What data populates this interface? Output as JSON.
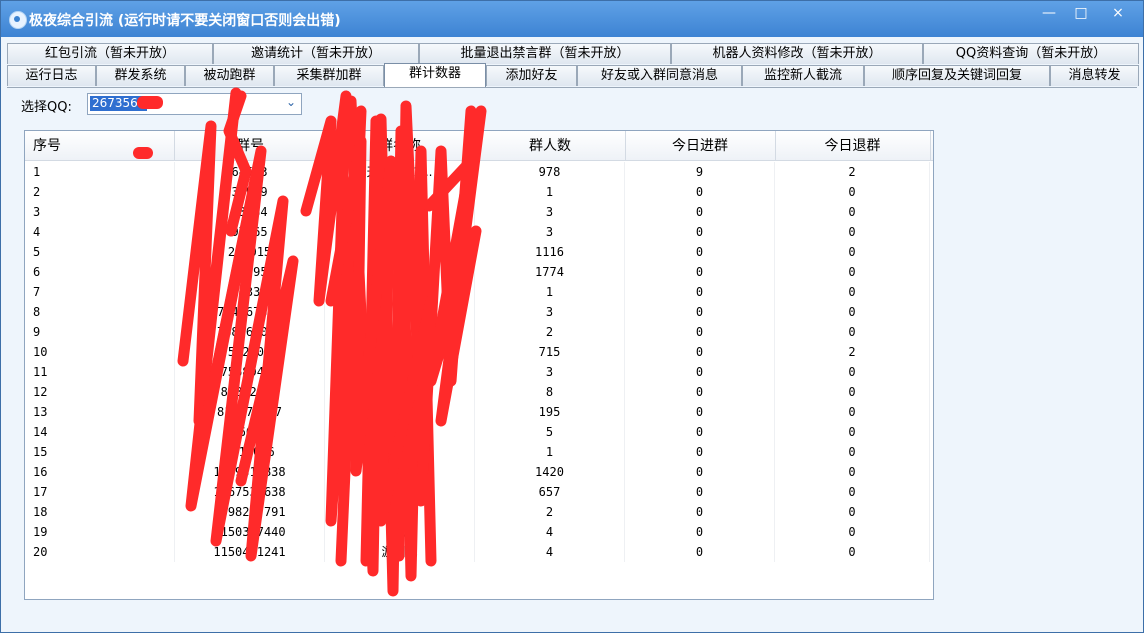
{
  "window": {
    "title": "极夜综合引流 (运行时请不要关闭窗口否则会出错)",
    "min_symbol": "—",
    "max_symbol": "□",
    "close_symbol": "×"
  },
  "tabs_row1": [
    "红包引流（暂未开放）",
    "邀请统计（暂未开放）",
    "批量退出禁言群（暂未开放）",
    "机器人资料修改（暂未开放）",
    "QQ资料查询（暂未开放）"
  ],
  "tabs_row2": [
    "运行日志",
    "群发系统",
    "被动跑群",
    "采集群加群",
    "群计数器",
    "添加好友",
    "好友或入群同意消息",
    "监控新人截流",
    "顺序回复及关键词回复",
    "消息转发"
  ],
  "active_tab": "群计数器",
  "qq_select": {
    "label": "选择QQ:",
    "value": "2673560"
  },
  "table": {
    "headers": [
      "序号",
      "群号",
      "群名称",
      "群人数",
      "今日进群",
      "今日退群"
    ],
    "rows": [
      [
        "1",
        "68573",
        "天...大...1...",
        "978",
        "9",
        "2"
      ],
      [
        "2",
        "35949",
        "",
        "1",
        "0",
        "0"
      ],
      [
        "3",
        "23764",
        "",
        "3",
        "0",
        "0"
      ],
      [
        "4",
        "97865",
        "",
        "3",
        "0",
        "0"
      ],
      [
        "5",
        "216015",
        "",
        "1116",
        "0",
        "0"
      ],
      [
        "6",
        "90795",
        "",
        "1774",
        "0",
        "0"
      ],
      [
        "7",
        "80335",
        "",
        "1",
        "0",
        "0"
      ],
      [
        "8",
        "704967514",
        "",
        "3",
        "0",
        "0"
      ],
      [
        "9",
        "768969070",
        "",
        "2",
        "0",
        "0"
      ],
      [
        "10",
        "75329079",
        "2..",
        "715",
        "0",
        "2"
      ],
      [
        "11",
        "75689412",
        "",
        "3",
        "0",
        "0"
      ],
      [
        "12",
        "81822240",
        "",
        "8",
        "0",
        "0"
      ],
      [
        "13",
        "811478557",
        "",
        "195",
        "0",
        "0"
      ],
      [
        "14",
        "8966907",
        "",
        "5",
        "0",
        "0"
      ],
      [
        "15",
        "1015016",
        "",
        "1",
        "0",
        "0"
      ],
      [
        "16",
        "1049316838",
        "大...",
        "1420",
        "0",
        "0"
      ],
      [
        "17",
        "1067535638",
        "助①群",
        "657",
        "0",
        "0"
      ],
      [
        "18",
        "1098217791",
        "",
        "2",
        "0",
        "0"
      ],
      [
        "19",
        "1150337440",
        "式",
        "4",
        "0",
        "0"
      ],
      [
        "20",
        "1150441241",
        "游测试",
        "4",
        "0",
        "0"
      ]
    ]
  },
  "redaction_color": "#ff2a2a"
}
